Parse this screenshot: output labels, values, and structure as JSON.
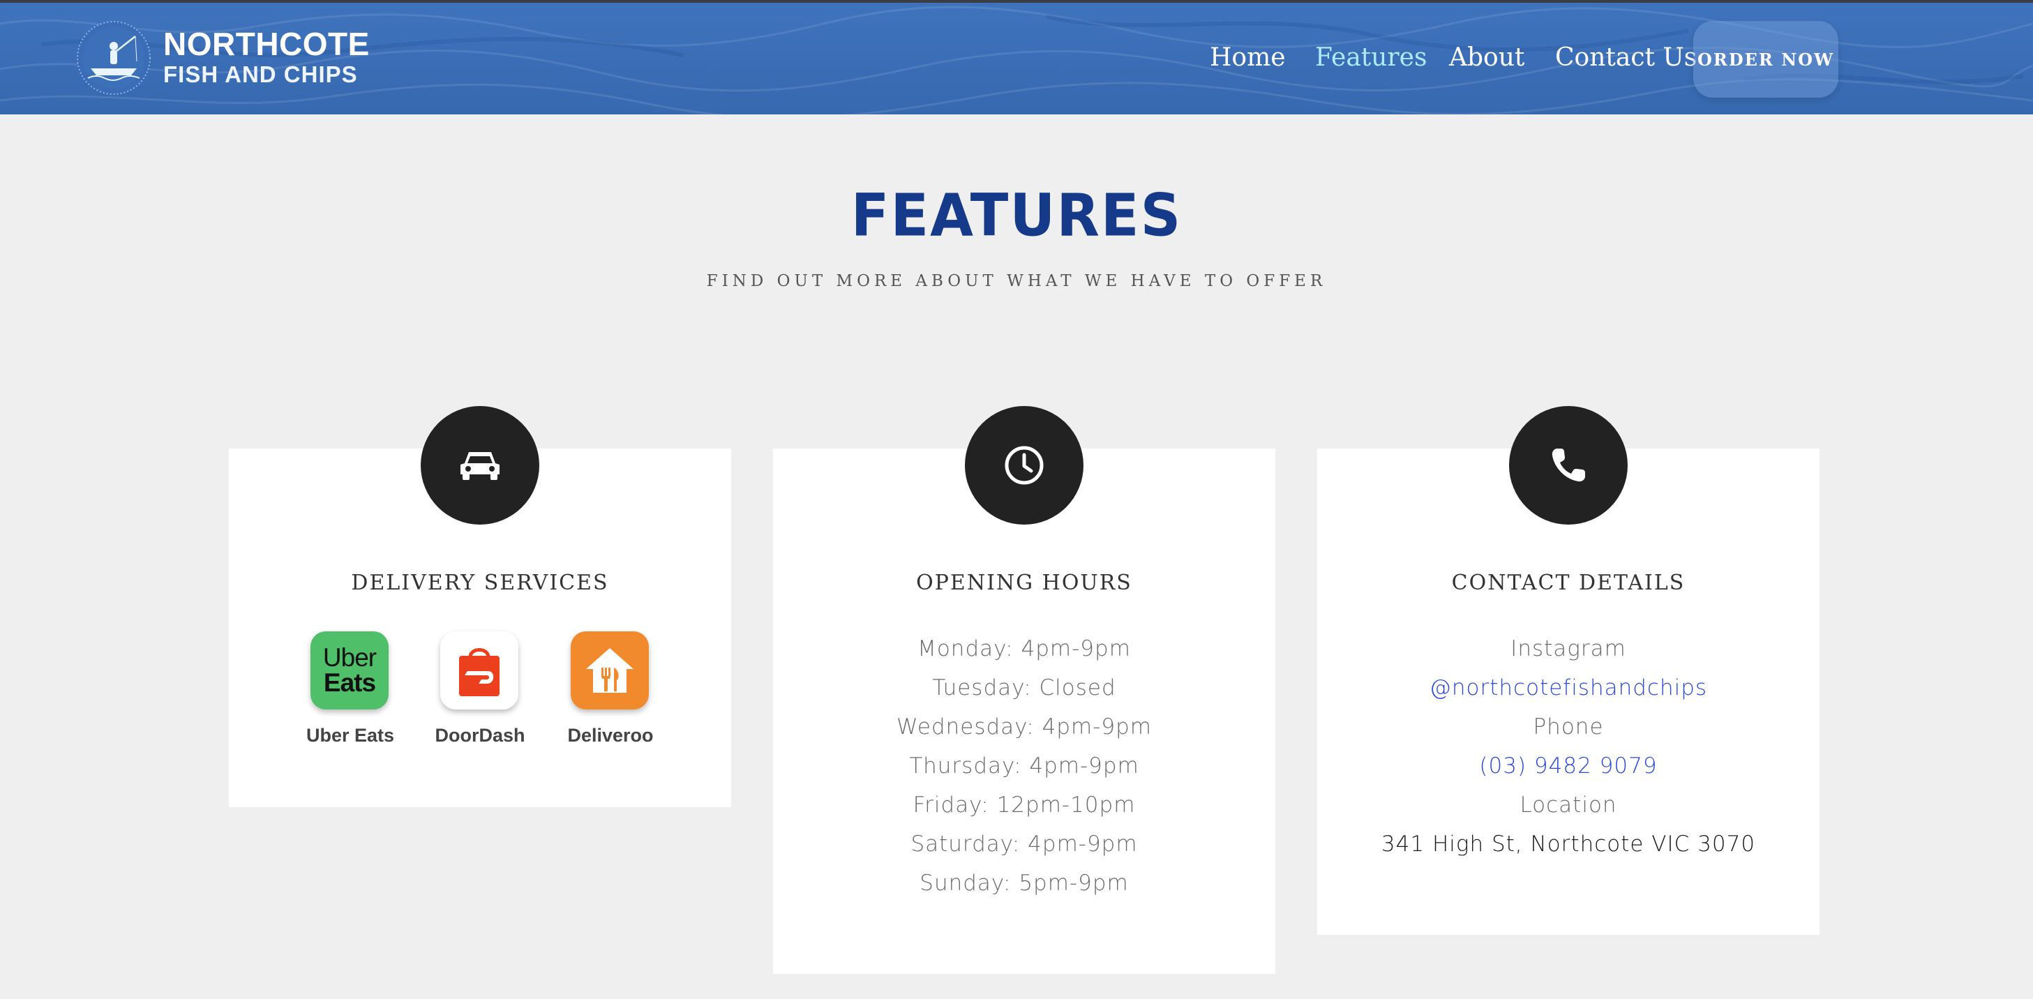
{
  "brand": {
    "line1": "NORTHCOTE",
    "line2": "FISH AND CHIPS"
  },
  "nav": {
    "items": [
      {
        "label": "Home"
      },
      {
        "label": "Features",
        "active": true
      },
      {
        "label": "About"
      },
      {
        "label": "Contact Us"
      }
    ],
    "order_label": "ORDER NOW"
  },
  "section": {
    "title": "FEATURES",
    "subtitle": "FIND OUT MORE ABOUT WHAT WE HAVE TO OFFER"
  },
  "cards": {
    "delivery": {
      "icon": "car-icon",
      "title": "DELIVERY SERVICES",
      "apps": [
        {
          "label": "Uber Eats",
          "tile_text_1": "Uber",
          "tile_text_2": "Eats",
          "color": "#4fbf6a"
        },
        {
          "label": "DoorDash",
          "color": "#eb3f1e"
        },
        {
          "label": "Deliveroo",
          "color": "#f08a2c"
        }
      ]
    },
    "hours": {
      "icon": "clock-icon",
      "title": "OPENING HOURS",
      "lines": [
        "Monday: 4pm-9pm",
        "Tuesday: Closed",
        "Wednesday: 4pm-9pm",
        "Thursday: 4pm-9pm",
        "Friday: 12pm-10pm",
        "Saturday: 4pm-9pm",
        "Sunday: 5pm-9pm"
      ]
    },
    "contact": {
      "icon": "phone-icon",
      "title": "CONTACT DETAILS",
      "instagram_label": "Instagram",
      "instagram_handle": "@northcotefishandchips",
      "phone_label": "Phone",
      "phone_number": "(03) 9482 9079",
      "location_label": "Location",
      "address": "341 High St, Northcote VIC 3070"
    }
  },
  "colors": {
    "header_blue": "#3a6db5",
    "title_blue": "#163a8a",
    "nav_active": "#a9ecfb",
    "link_blue": "#2a49d8",
    "icon_circle": "#222222"
  }
}
